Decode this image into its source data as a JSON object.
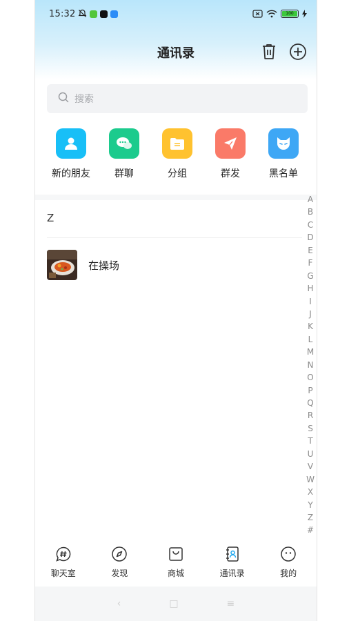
{
  "status_bar": {
    "time": "15:32",
    "battery": "100"
  },
  "header": {
    "title": "通讯录"
  },
  "search": {
    "placeholder": "搜索"
  },
  "quick_actions": [
    {
      "label": "新的朋友",
      "icon": "person-icon",
      "color": "#18bff7"
    },
    {
      "label": "群聊",
      "icon": "chat-bubble-icon",
      "color": "#1ccb8d"
    },
    {
      "label": "分组",
      "icon": "folder-icon",
      "color": "#ffc22f"
    },
    {
      "label": "群发",
      "icon": "paper-plane-icon",
      "color": "#fa7a68"
    },
    {
      "label": "黑名单",
      "icon": "blocked-face-icon",
      "color": "#3ea7f5"
    }
  ],
  "contacts": {
    "section": "Z",
    "items": [
      {
        "name": "在操场"
      }
    ]
  },
  "index_letters": [
    "A",
    "B",
    "C",
    "D",
    "E",
    "F",
    "G",
    "H",
    "I",
    "J",
    "K",
    "L",
    "M",
    "N",
    "O",
    "P",
    "Q",
    "R",
    "S",
    "T",
    "U",
    "V",
    "W",
    "X",
    "Y",
    "Z",
    "#"
  ],
  "tabs": [
    {
      "label": "聊天室",
      "icon": "hash-chat-icon"
    },
    {
      "label": "发现",
      "icon": "compass-icon"
    },
    {
      "label": "商城",
      "icon": "shopping-bag-icon"
    },
    {
      "label": "通讯录",
      "icon": "contacts-book-icon",
      "active": true
    },
    {
      "label": "我的",
      "icon": "smiley-icon"
    }
  ],
  "system_nav": {
    "back": "‹",
    "home": "□",
    "menu": "≡"
  }
}
